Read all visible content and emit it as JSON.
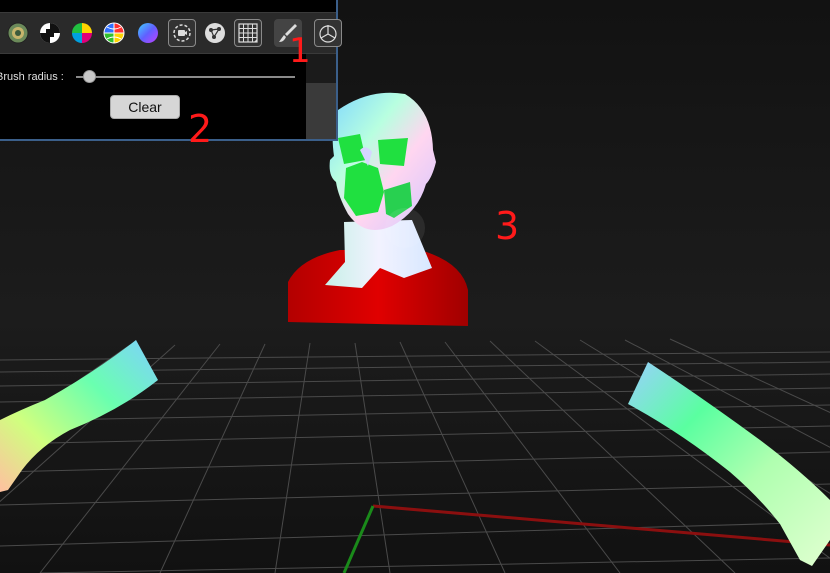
{
  "viewport": {
    "scene_objects": [
      "head-bust",
      "left-arm",
      "right-arm",
      "floor-grid",
      "x-axis",
      "y-axis"
    ]
  },
  "toolbar": {
    "tools": [
      {
        "icon": "sphere-icon",
        "name": "sphere-tool"
      },
      {
        "icon": "checker-icon",
        "name": "checker-tool"
      },
      {
        "icon": "color-wheel-icon",
        "name": "color-wheel-tool"
      },
      {
        "icon": "color-globe-icon",
        "name": "color-globe-tool"
      },
      {
        "icon": "gradient-sphere-icon",
        "name": "gradient-sphere-tool"
      },
      {
        "icon": "camera-rotate-icon",
        "name": "camera-rotate-tool"
      },
      {
        "icon": "node-graph-icon",
        "name": "node-graph-tool"
      },
      {
        "icon": "grid-icon",
        "name": "grid-tool"
      },
      {
        "icon": "brush-icon",
        "name": "brush-tool"
      },
      {
        "icon": "gizmo-icon",
        "name": "gizmo-tool"
      }
    ],
    "active_tool": "brush-tool"
  },
  "tool_options": {
    "brush_radius_label": "Brush radius :",
    "brush_radius_value": 0.06,
    "clear_label": "Clear"
  },
  "callouts": {
    "one": "1",
    "two": "2",
    "three": "3"
  },
  "colors": {
    "panel_border": "#3b5f8a",
    "callout": "#ff1a1a",
    "x_axis": "#8b0f0f",
    "y_axis": "#1a8a1a",
    "shirt": "#b00000"
  }
}
